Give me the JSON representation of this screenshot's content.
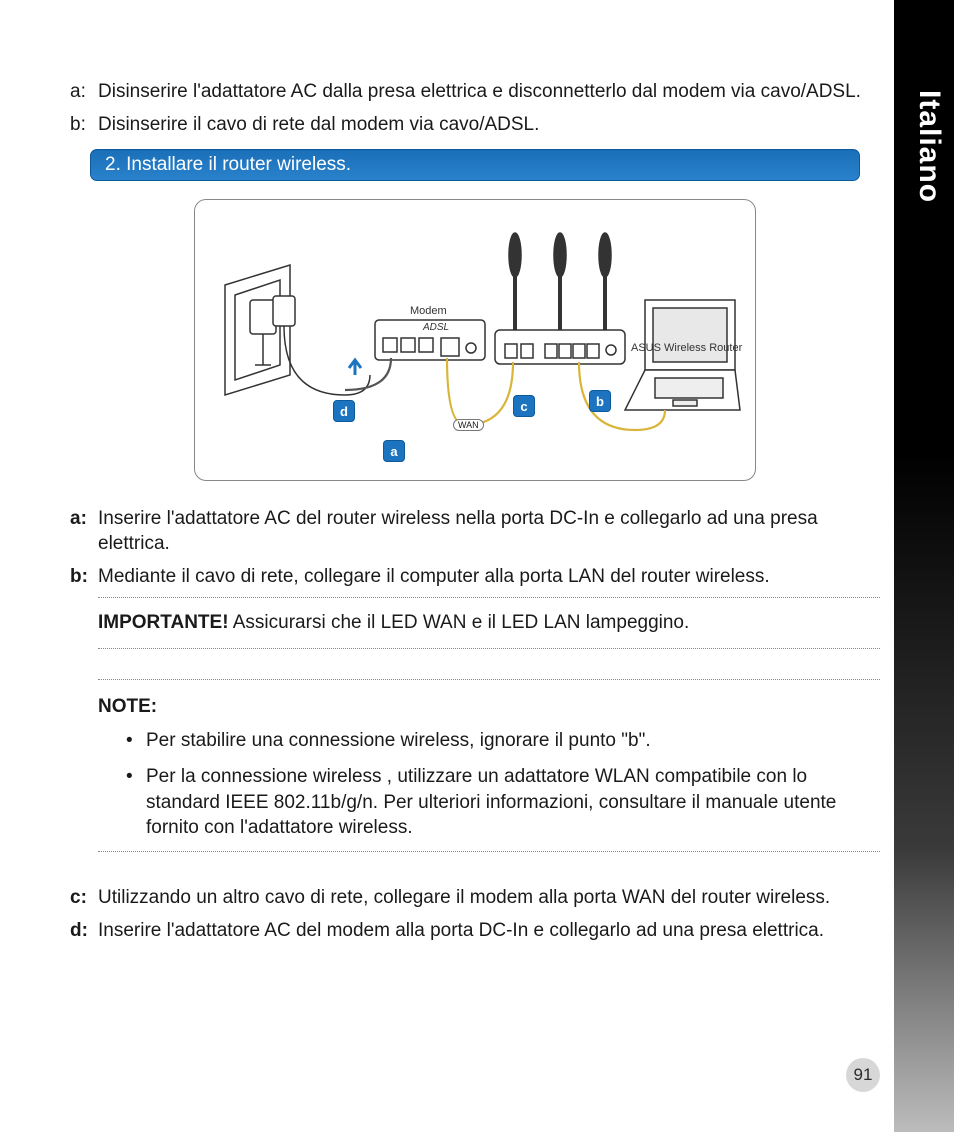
{
  "sideTab": "Italiano",
  "pageNumber": "91",
  "intro": {
    "a_label": "a:",
    "a_text": "Disinserire l'adattatore AC dalla presa elettrica e disconnetterlo dal modem via cavo/ADSL.",
    "b_label": "b:",
    "b_text": "Disinserire il cavo di rete dal modem via cavo/ADSL."
  },
  "step": "2.  Installare il router wireless.",
  "diagram": {
    "modem_label": "Modem",
    "adsl_label": "ADSL",
    "router_label": "ASUS Wireless Router",
    "wan_tag": "WAN",
    "markers": {
      "a": "a",
      "b": "b",
      "c": "c",
      "d": "d"
    }
  },
  "steps": {
    "a_label": "a:",
    "a_text": "Inserire l'adattatore AC del router wireless nella porta DC-In e collegarlo ad una presa elettrica.",
    "b_label": "b:",
    "b_text": "Mediante il cavo di rete, collegare il computer alla porta LAN del router wireless.",
    "c_label": "c:",
    "c_text": "Utilizzando un altro cavo di rete, collegare il modem alla porta WAN del router wireless.",
    "d_label": "d:",
    "d_text": "Inserire l'adattatore AC del modem alla porta DC-In e collegarlo ad una presa elettrica."
  },
  "important_label": "IMPORTANTE!",
  "important_text": "  Assicurarsi che il LED WAN e il LED LAN lampeggino.",
  "note_label": "NOTE:",
  "notes": {
    "n1": "Per stabilire una connessione wireless, ignorare il punto \"b\".",
    "n2": "Per la connessione wireless , utilizzare un adattatore WLAN compatibile con lo standard IEEE 802.11b/g/n. Per ulteriori informazioni, consultare il manuale utente fornito con l'adattatore wireless."
  }
}
